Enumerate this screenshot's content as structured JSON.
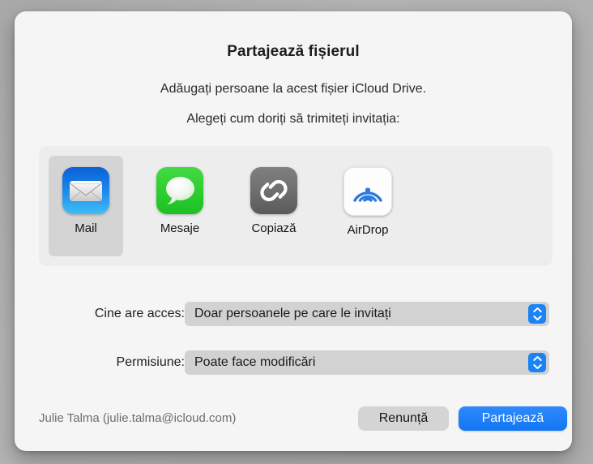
{
  "dialog": {
    "title": "Partajează fișierul",
    "subtitle_line1": "Adăugați persoane la acest fișier iCloud Drive.",
    "subtitle_line2": "Alegeți cum doriți să trimiteți invitația:"
  },
  "share_methods": [
    {
      "id": "mail",
      "label": "Mail",
      "icon": "mail-app-icon",
      "selected": true
    },
    {
      "id": "messages",
      "label": "Mesaje",
      "icon": "messages-app-icon",
      "selected": false
    },
    {
      "id": "copy",
      "label": "Copiază",
      "icon": "link-chain-icon",
      "selected": false
    },
    {
      "id": "airdrop",
      "label": "AirDrop",
      "icon": "airdrop-icon",
      "selected": false
    }
  ],
  "options": {
    "access": {
      "label": "Cine are acces:",
      "value": "Doar persoanele pe care le invitați"
    },
    "permission": {
      "label": "Permisiune:",
      "value": "Poate face modificări"
    }
  },
  "footer": {
    "account": "Julie Talma (julie.talma@icloud.com)",
    "cancel_label": "Renunță",
    "share_label": "Partajează"
  },
  "colors": {
    "accent_blue": "#1a84f5",
    "dialog_background": "#f5f5f5",
    "panel_background": "#ededed",
    "selected_cell": "#d4d4d4",
    "control_gray": "#d2d2d2"
  }
}
